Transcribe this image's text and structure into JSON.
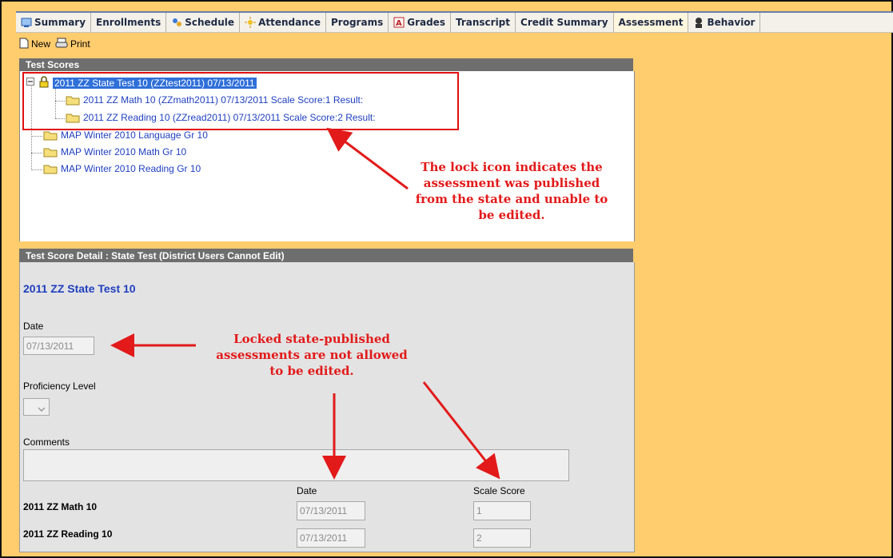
{
  "tabs": [
    {
      "label": "Summary",
      "icon": "summary-icon",
      "active": false
    },
    {
      "label": "Enrollments",
      "icon": "",
      "active": false
    },
    {
      "label": "Schedule",
      "icon": "schedule-icon",
      "active": false
    },
    {
      "label": "Attendance",
      "icon": "attendance-icon",
      "active": false
    },
    {
      "label": "Programs",
      "icon": "",
      "active": false
    },
    {
      "label": "Grades",
      "icon": "grades-icon",
      "active": false
    },
    {
      "label": "Transcript",
      "icon": "",
      "active": false
    },
    {
      "label": "Credit Summary",
      "icon": "",
      "active": false
    },
    {
      "label": "Assessment",
      "icon": "",
      "active": true
    },
    {
      "label": "Behavior",
      "icon": "behavior-icon",
      "active": false
    }
  ],
  "toolbar": {
    "new_label": "New",
    "print_label": "Print"
  },
  "test_scores": {
    "header": "Test Scores",
    "items": [
      {
        "label": "2011 ZZ State Test 10 (ZZtest2011) 07/13/2011",
        "selected": true,
        "locked": true
      },
      {
        "label": "2011 ZZ Math 10 (ZZmath2011) 07/13/2011 Scale Score:1 Result:"
      },
      {
        "label": "2011 ZZ Reading 10 (ZZread2011) 07/13/2011 Scale Score:2 Result:"
      },
      {
        "label": "MAP Winter 2010 Language Gr 10"
      },
      {
        "label": "MAP Winter 2010 Math Gr 10"
      },
      {
        "label": "MAP Winter 2010 Reading Gr 10"
      }
    ]
  },
  "annotations": {
    "lock_note": [
      "The lock icon indicates the",
      "assessment was published",
      "from the state and unable to",
      "be edited."
    ],
    "edit_note": [
      "Locked state-published",
      "assessments are not allowed",
      "to be edited."
    ]
  },
  "detail": {
    "header": "Test Score Detail : State Test (District Users Cannot Edit)",
    "title": "2011 ZZ State Test 10",
    "date_label": "Date",
    "date_value": "07/13/2011",
    "proficiency_label": "Proficiency Level",
    "comments_label": "Comments",
    "col_date": "Date",
    "col_scale": "Scale Score",
    "rows": [
      {
        "name": "2011 ZZ Math 10",
        "date": "07/13/2011",
        "score": "1"
      },
      {
        "name": "2011 ZZ Reading 10",
        "date": "07/13/2011",
        "score": "2"
      }
    ]
  },
  "colors": {
    "background": "#ffcc6e",
    "annotation": "#e21a1a",
    "link": "#1f3fbf",
    "header": "#6e6e6e"
  }
}
